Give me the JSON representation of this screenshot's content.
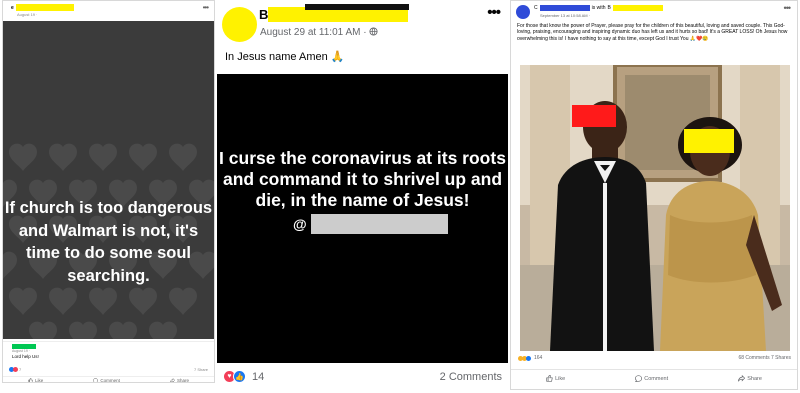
{
  "post1": {
    "author_initial": "e",
    "date": "August 19 ·",
    "image_text": "If church is too dangerous and Walmart is not, it's time to do some soul searching.",
    "shared_date": "August 19 ·",
    "caption": "Lord help Us!",
    "reaction_count": "7",
    "share_count": "7 Share",
    "actions": {
      "like": "Like",
      "comment": "Comment",
      "share": "Share"
    }
  },
  "post2": {
    "author_initial": "B",
    "date": "August 29 at 11:01 AM · ",
    "caption": "In Jesus name Amen 🙏",
    "image_text": "I curse the coronavirus at its roots and command it to shrivel up and die, in the name of Jesus!",
    "handle_prefix": "@",
    "reaction_count": "14",
    "comments": "2 Comments"
  },
  "post3": {
    "author_initial": "C",
    "with_text": "is with",
    "with_initial": "B",
    "date": "September 13 at 10:58 AM ·",
    "text": "For those that know the power of Prayer,  please pray for the children of this beautiful, loving and saved couple. This God-loving, praising, encouraging and inspiring dynamic duo has left us and it hurts so bad! It's a GREAT LOSS! Oh Jesus how overwhelming this is! I have nothing to say at this time, except God I trust You 🙏❤️😢",
    "reaction_count": "164",
    "counts_right": "68 Comments 7 Shares",
    "actions": {
      "like": "Like",
      "comment": "Comment",
      "share": "Share"
    }
  },
  "icons": [
    "more-icon",
    "globe-icon",
    "like-icon",
    "comment-icon",
    "share-icon",
    "heart-icon",
    "sad-icon",
    "pray-icon"
  ],
  "colors": {
    "facebook_blue": "#1877f2",
    "love_red": "#f33e58",
    "redaction_yellow": "#fff200",
    "redaction_red": "#ff1a1a"
  }
}
